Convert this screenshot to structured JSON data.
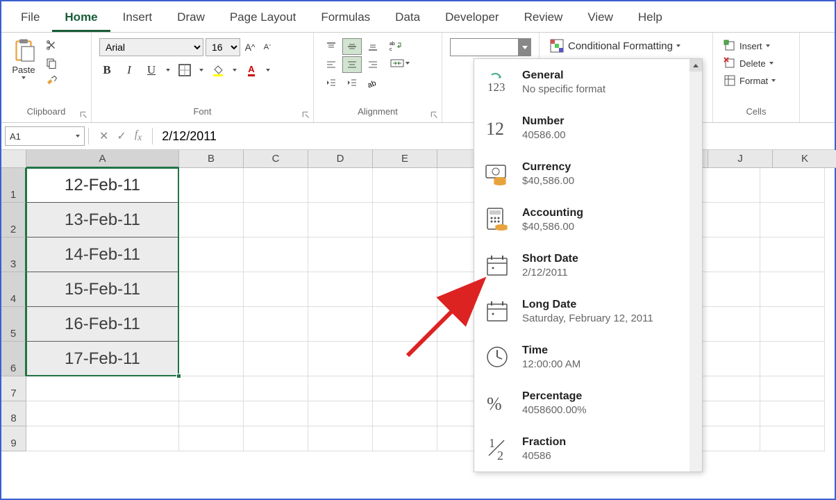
{
  "tabs": [
    "File",
    "Home",
    "Insert",
    "Draw",
    "Page Layout",
    "Formulas",
    "Data",
    "Developer",
    "Review",
    "View",
    "Help"
  ],
  "active_tab": "Home",
  "clipboard": {
    "paste": "Paste",
    "label": "Clipboard"
  },
  "font": {
    "name": "Arial",
    "size": "16",
    "label": "Font",
    "bold": "B",
    "italic": "I",
    "underline": "U"
  },
  "alignment": {
    "label": "Alignment"
  },
  "styles": {
    "conditional": "Conditional Formatting"
  },
  "cells": {
    "insert": "Insert",
    "delete": "Delete",
    "format": "Format",
    "label": "Cells"
  },
  "namebox": "A1",
  "formula": "2/12/2011",
  "columns": [
    "A",
    "B",
    "C",
    "D",
    "E",
    "J",
    "K"
  ],
  "col_widths": {
    "A": 220,
    "other": 93
  },
  "rows": [
    {
      "n": 1,
      "a": "12-Feb-11"
    },
    {
      "n": 2,
      "a": "13-Feb-11"
    },
    {
      "n": 3,
      "a": "14-Feb-11"
    },
    {
      "n": 4,
      "a": "15-Feb-11"
    },
    {
      "n": 5,
      "a": "16-Feb-11"
    },
    {
      "n": 6,
      "a": "17-Feb-11"
    },
    {
      "n": 7,
      "a": ""
    },
    {
      "n": 8,
      "a": ""
    },
    {
      "n": 9,
      "a": ""
    }
  ],
  "format_dropdown": [
    {
      "title": "General",
      "sub": "No specific format",
      "icon": "general"
    },
    {
      "title": "Number",
      "sub": "40586.00",
      "icon": "number"
    },
    {
      "title": "Currency",
      "sub": "$40,586.00",
      "icon": "currency"
    },
    {
      "title": "Accounting",
      "sub": " $40,586.00",
      "icon": "accounting"
    },
    {
      "title": "Short Date",
      "sub": "2/12/2011",
      "icon": "shortdate"
    },
    {
      "title": "Long Date",
      "sub": "Saturday, February 12, 2011",
      "icon": "longdate"
    },
    {
      "title": "Time",
      "sub": "12:00:00 AM",
      "icon": "time"
    },
    {
      "title": "Percentage",
      "sub": "4058600.00%",
      "icon": "percentage"
    },
    {
      "title": "Fraction",
      "sub": "40586",
      "icon": "fraction"
    }
  ]
}
